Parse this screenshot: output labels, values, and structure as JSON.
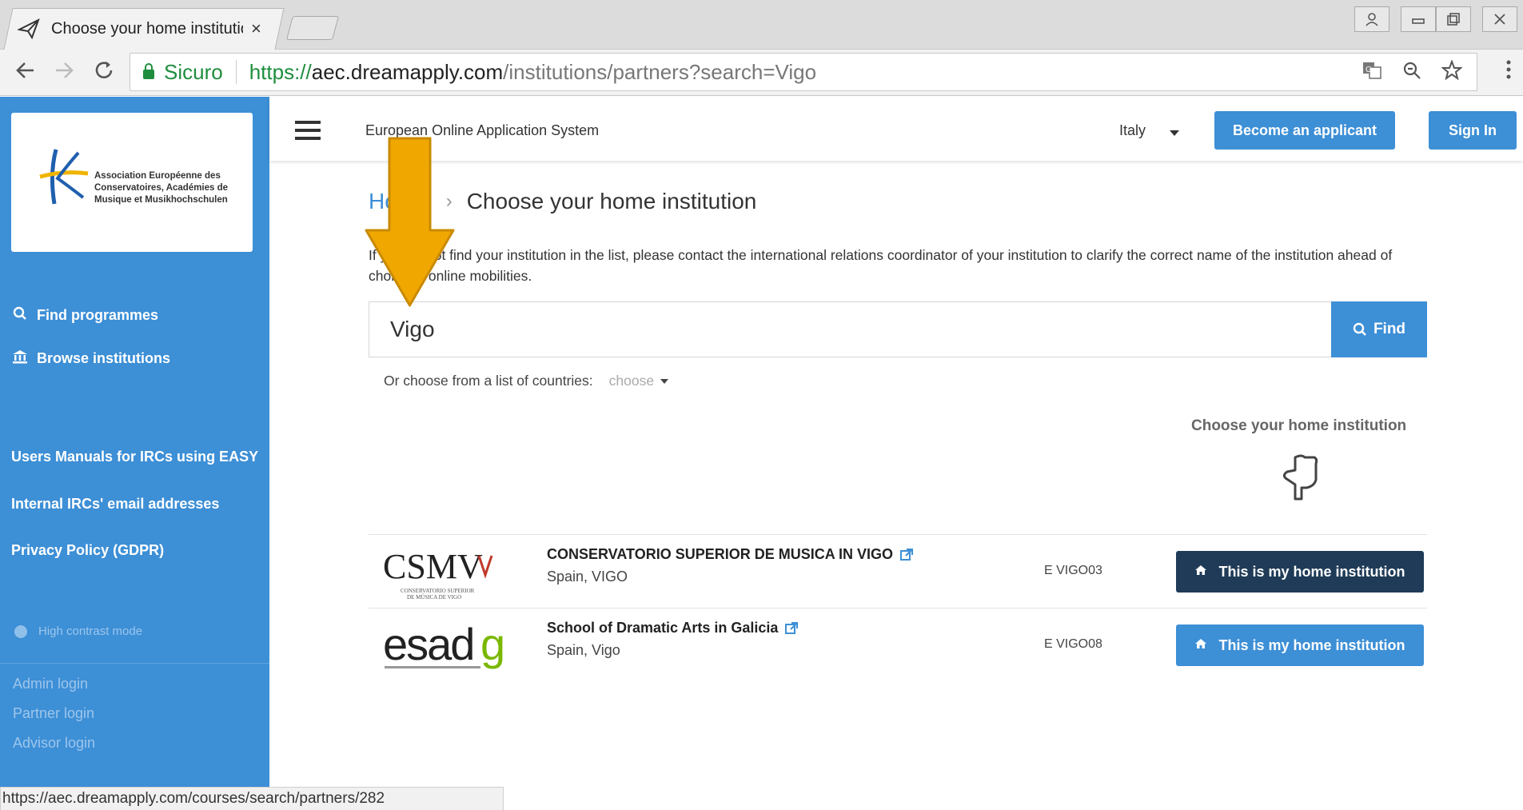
{
  "browser": {
    "tab_title": "Choose your home institutio",
    "tab_close": "×",
    "secure_label": "Sicuro",
    "url_scheme": "https://",
    "url_host": "aec.dreamapply.com",
    "url_path": "/institutions/partners?search=Vigo",
    "status_url": "https://aec.dreamapply.com/courses/search/partners/282"
  },
  "sidebar": {
    "logo_text": "Association Européenne des Conservatoires, Académies de Musique et Musikhochschulen",
    "nav": [
      {
        "label": "Find programmes",
        "icon": "search-icon"
      },
      {
        "label": "Browse institutions",
        "icon": "institution-icon"
      }
    ],
    "links": [
      "Users Manuals for IRCs using EASY",
      "Internal IRCs' email addresses",
      "Privacy Policy (GDPR)"
    ],
    "high_contrast": "High contrast mode",
    "logins": [
      "Admin login",
      "Partner login",
      "Advisor login"
    ]
  },
  "header": {
    "system_title": "European Online Application System",
    "country": "Italy",
    "become_applicant": "Become an applicant",
    "sign_in": "Sign In"
  },
  "page": {
    "breadcrumb_home": "Home",
    "breadcrumb_sep": "›",
    "title": "Choose your home institution",
    "info": "If you do not find your institution in the list, please contact the international relations coordinator of your institution to clarify the correct name of the institution ahead of choice of online mobilities.",
    "search_value": "Vigo",
    "find_label": "Find",
    "countries_label": "Or choose from a list of countries:",
    "choose_placeholder": "choose",
    "hint": "Choose your home institution"
  },
  "results": [
    {
      "name": "CONSERVATORIO SUPERIOR DE MUSICA IN VIGO",
      "location": "Spain, VIGO",
      "code": "E VIGO03",
      "button": "This is my home institution",
      "button_color": "#1f3b57",
      "logo": "CSMV"
    },
    {
      "name": "School of Dramatic Arts in Galicia",
      "location": "Spain, Vigo",
      "code": "E VIGO08",
      "button": "This is my home institution",
      "button_color": "#3d8fd6",
      "logo": "esadg"
    }
  ],
  "colors": {
    "primary": "#3d8fd6",
    "dark_button": "#1f3b57",
    "arrow": "#f0a800"
  }
}
